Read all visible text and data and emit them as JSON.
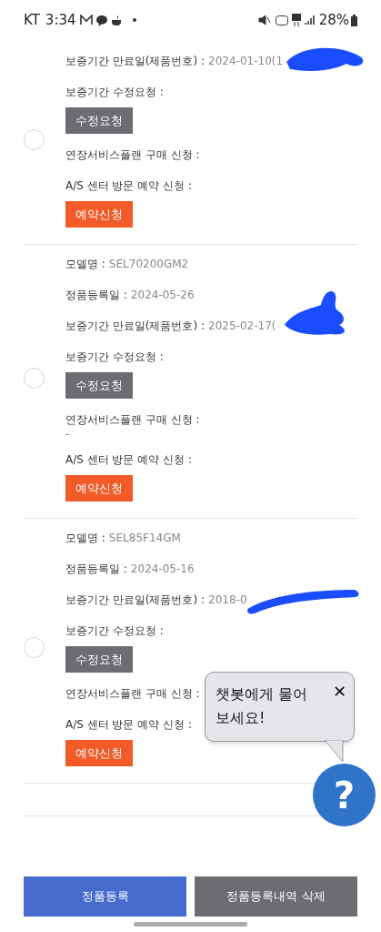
{
  "status_bar": {
    "carrier": "KT",
    "time": "3:34",
    "battery": "28%"
  },
  "products": [
    {
      "selected": false,
      "rows": [
        {
          "kind": "field",
          "label": "보증기간 만료일(제품번호) :",
          "value": "2024-01-10(1",
          "redacted": true
        },
        {
          "kind": "field",
          "label": "보증기간 수정요청 :"
        },
        {
          "kind": "edit_button",
          "label": "수정요청"
        },
        {
          "kind": "field",
          "label": "연장서비스플랜 구매 신청 :"
        },
        {
          "kind": "field",
          "label": "A/S 센터 방문 예약 신청 :"
        },
        {
          "kind": "booking_button",
          "label": "예약신청"
        }
      ]
    },
    {
      "selected": false,
      "rows": [
        {
          "kind": "field",
          "label": "모델명 :",
          "value": "SEL70200GM2"
        },
        {
          "kind": "field",
          "label": "정품등록일 :",
          "value": "2024-05-26"
        },
        {
          "kind": "field",
          "label": "보증기간 만료일(제품번호) :",
          "value": "2025-02-17(",
          "redacted": true
        },
        {
          "kind": "field",
          "label": "보증기간 수정요청 :"
        },
        {
          "kind": "edit_button",
          "label": "수정요청"
        },
        {
          "kind": "field",
          "label": "연장서비스플랜 구매 신청 :"
        },
        {
          "kind": "dash",
          "label": "-"
        },
        {
          "kind": "field",
          "label": "A/S 센터 방문 예약 신청 :"
        },
        {
          "kind": "booking_button",
          "label": "예약신청"
        }
      ]
    },
    {
      "selected": false,
      "rows": [
        {
          "kind": "field",
          "label": "모델명 :",
          "value": "SEL85F14GM"
        },
        {
          "kind": "field",
          "label": "정품등록일 :",
          "value": "2024-05-16"
        },
        {
          "kind": "field",
          "label": "보증기간 만료일(제품번호) :",
          "value": "2018-0",
          "redacted": true
        },
        {
          "kind": "field",
          "label": "보증기간 수정요청 :"
        },
        {
          "kind": "edit_button",
          "label": "수정요청"
        },
        {
          "kind": "field",
          "label": "연장서비스플랜 구매 신청 :"
        },
        {
          "kind": "field",
          "label": "A/S 센터 방문 예약 신청 :"
        },
        {
          "kind": "booking_button",
          "label": "예약신청"
        }
      ]
    }
  ],
  "chatbot_tooltip": {
    "text": "챗봇에게 물어보세요!",
    "close": "✕",
    "button": "?"
  },
  "footer_buttons": [
    {
      "label": "정품등록",
      "kind": "primary"
    },
    {
      "label": "정품등록내역 삭제",
      "kind": "secondary"
    }
  ]
}
